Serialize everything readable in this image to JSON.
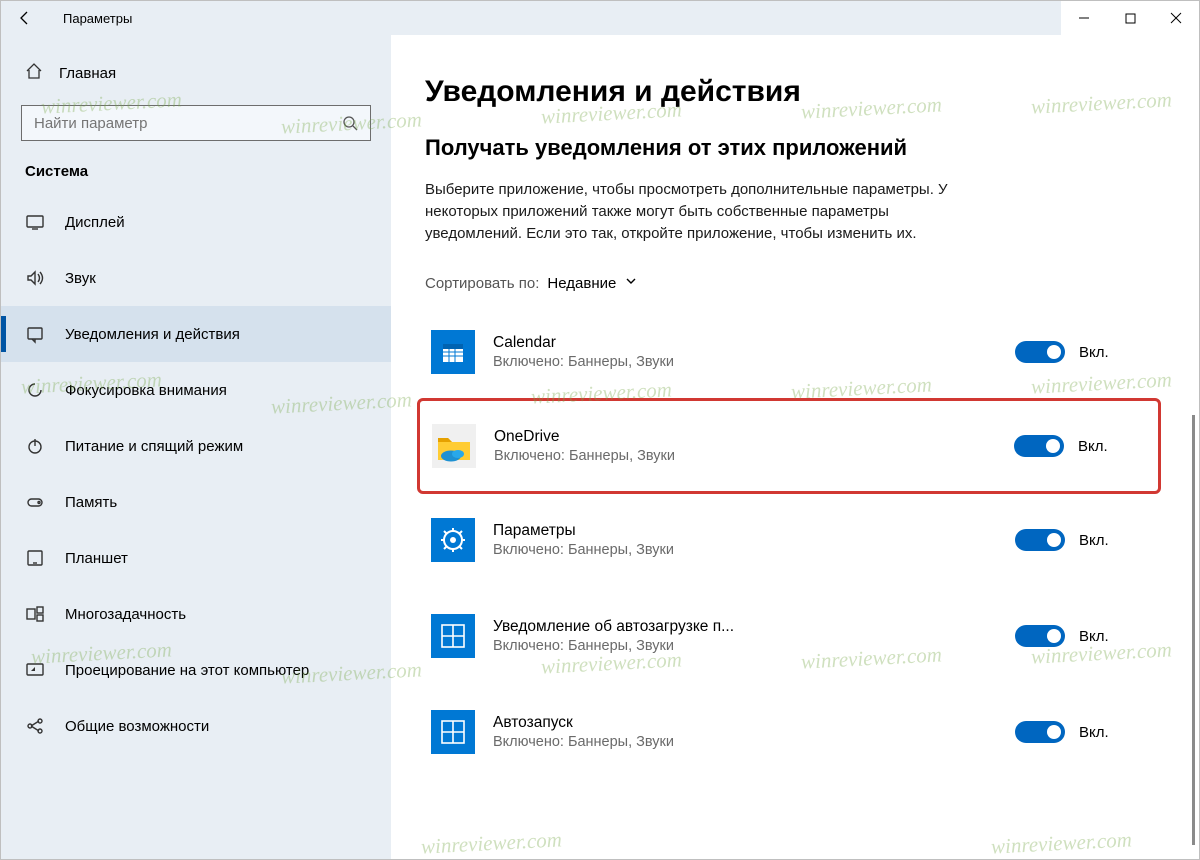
{
  "window": {
    "title": "Параметры"
  },
  "sidebar": {
    "home_label": "Главная",
    "search_placeholder": "Найти параметр",
    "category_label": "Система",
    "items": [
      {
        "label": "Дисплей"
      },
      {
        "label": "Звук"
      },
      {
        "label": "Уведомления и действия"
      },
      {
        "label": "Фокусировка внимания"
      },
      {
        "label": "Питание и спящий режим"
      },
      {
        "label": "Память"
      },
      {
        "label": "Планшет"
      },
      {
        "label": "Многозадачность"
      },
      {
        "label": "Проецирование на этот компьютер"
      },
      {
        "label": "Общие возможности"
      }
    ]
  },
  "content": {
    "heading": "Уведомления и действия",
    "subheading": "Получать уведомления от этих приложений",
    "description": "Выберите приложение, чтобы просмотреть дополнительные параметры. У некоторых приложений также могут быть собственные параметры уведомлений. Если это так, откройте приложение, чтобы изменить их.",
    "sort_label": "Сортировать по:",
    "sort_value": "Недавние",
    "apps": [
      {
        "name": "Calendar",
        "detail": "Включено: Баннеры, Звуки",
        "state": "Вкл."
      },
      {
        "name": "OneDrive",
        "detail": "Включено: Баннеры, Звуки",
        "state": "Вкл."
      },
      {
        "name": "Параметры",
        "detail": "Включено: Баннеры, Звуки",
        "state": "Вкл."
      },
      {
        "name": "Уведомление об автозагрузке п...",
        "detail": "Включено: Баннеры, Звуки",
        "state": "Вкл."
      },
      {
        "name": "Автозапуск",
        "detail": "Включено: Баннеры, Звуки",
        "state": "Вкл."
      }
    ]
  },
  "watermark": "winreviewer.com"
}
